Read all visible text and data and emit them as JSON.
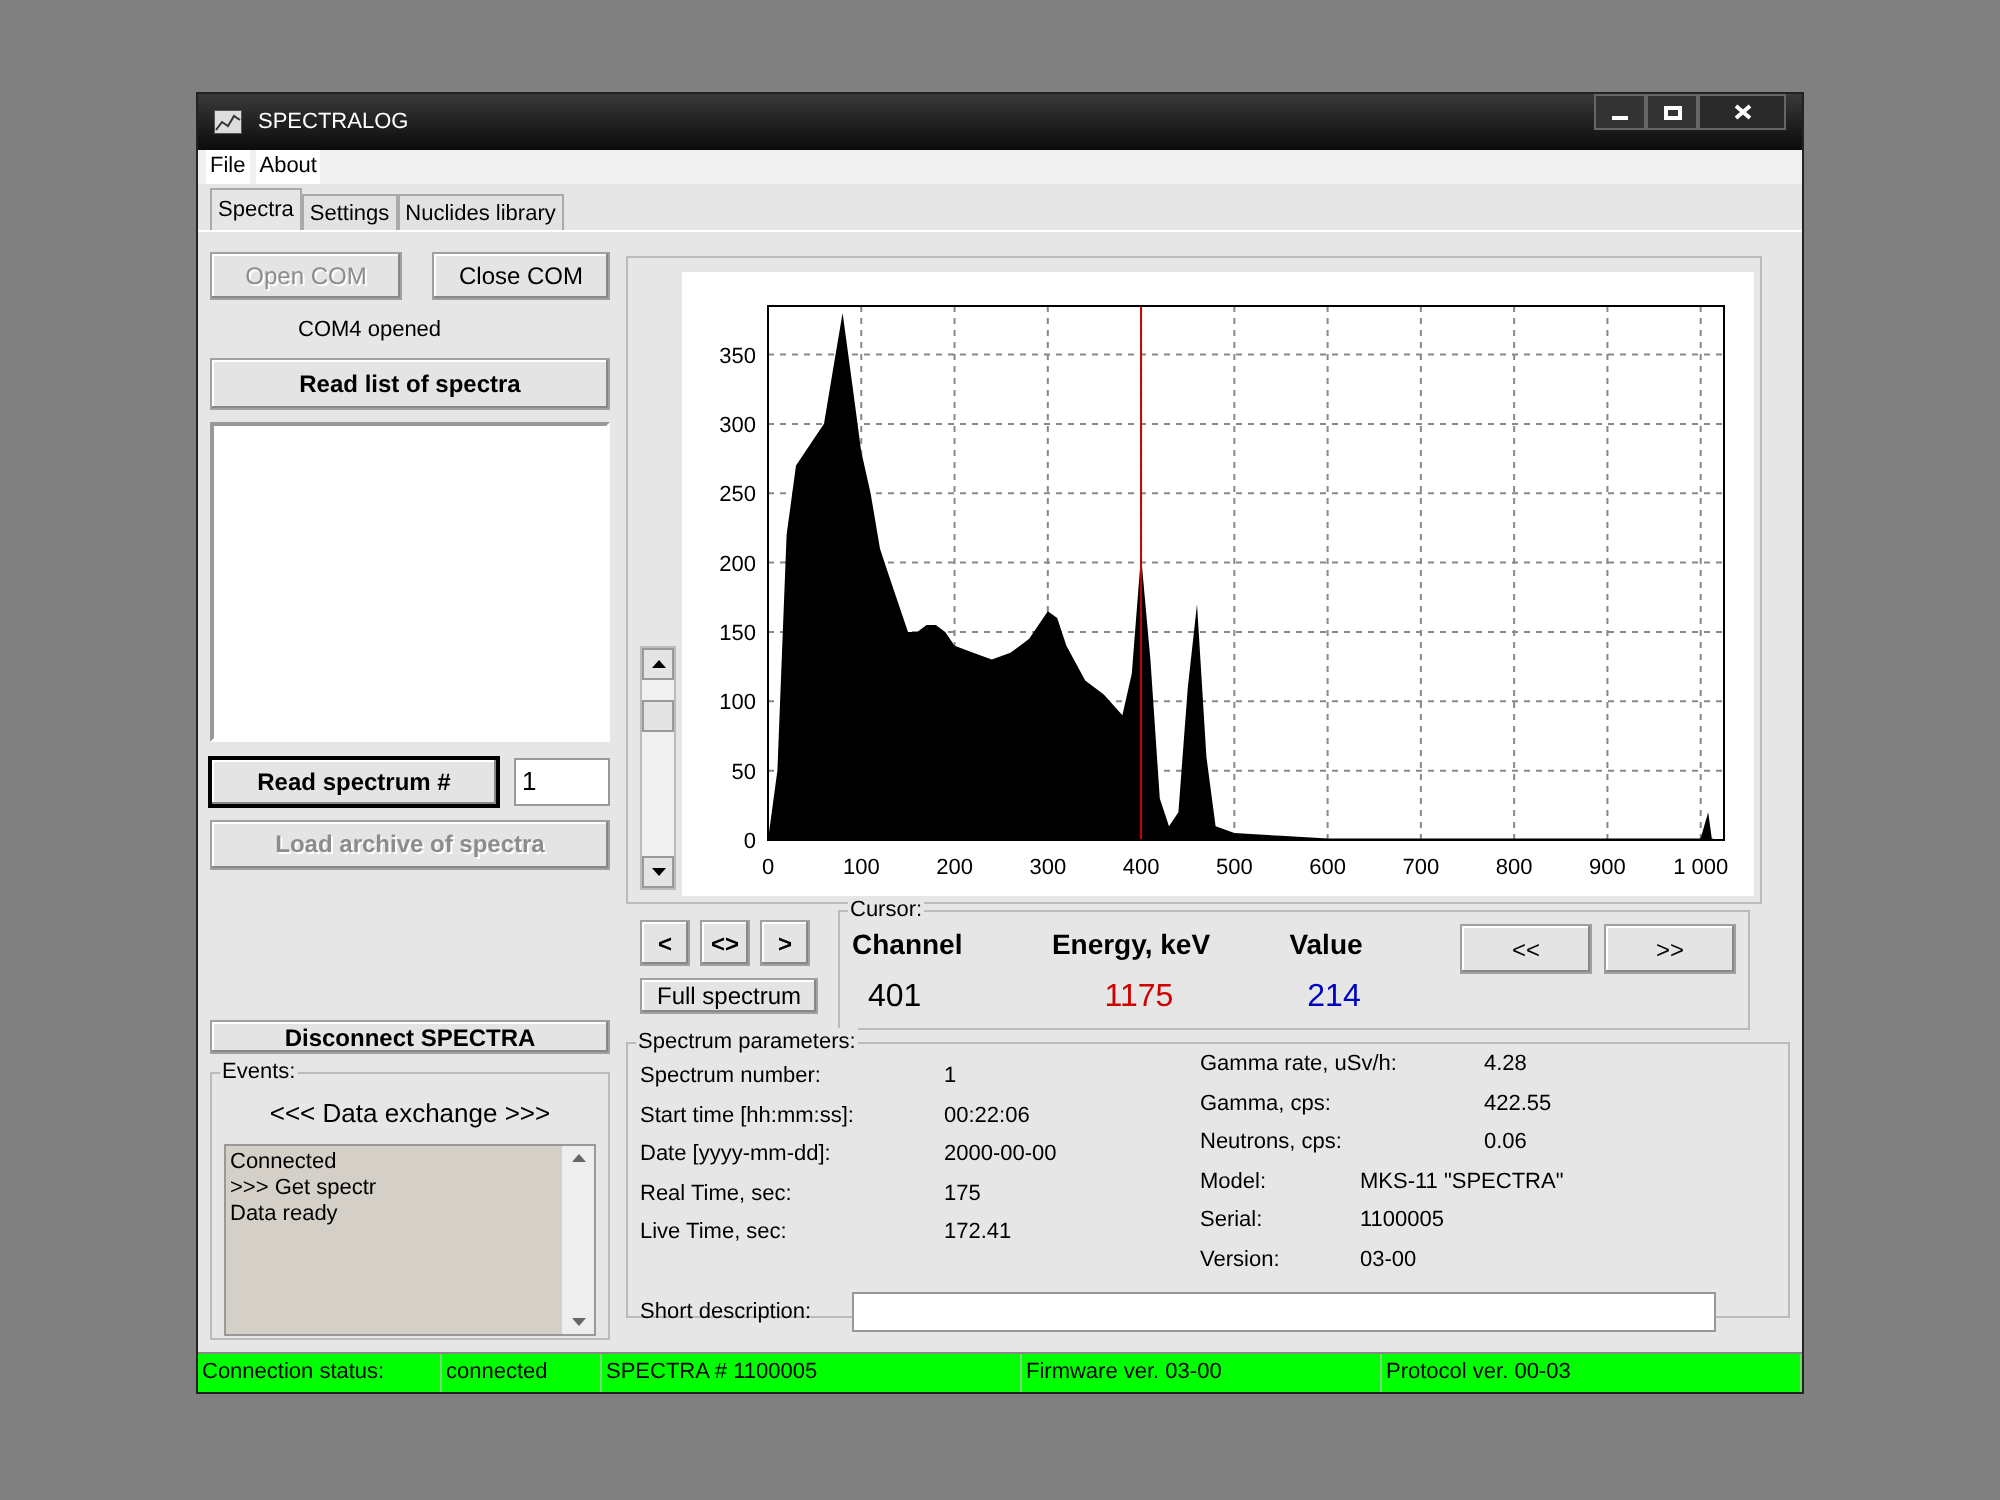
{
  "window": {
    "title": "SPECTRALOG"
  },
  "menu": [
    {
      "label": "File"
    },
    {
      "label": "About"
    }
  ],
  "tabs": [
    {
      "label": "Spectra",
      "selected": true
    },
    {
      "label": "Settings",
      "selected": false
    },
    {
      "label": "Nuclides library",
      "selected": false
    }
  ],
  "com": {
    "open_button": {
      "label": "Open COM",
      "disabled": true
    },
    "close_button": {
      "label": "Close COM",
      "disabled": false
    },
    "status": "COM4 opened"
  },
  "read_list_button": {
    "label": "Read list of spectra",
    "disabled": false
  },
  "read_spectrum": {
    "button": {
      "label": "Read spectrum #",
      "disabled": false
    },
    "value": "1"
  },
  "load_archive_button": {
    "label": "Load archive of spectra",
    "disabled": true
  },
  "disconnect_button": {
    "label": "Disconnect SPECTRA",
    "disabled": false
  },
  "events": {
    "title": "Events:",
    "heading": "<<< Data exchange >>>",
    "lines": [
      "Connected",
      ">>> Get spectr",
      "Data ready"
    ]
  },
  "chart": {
    "chart_data": {
      "type": "area",
      "x": [
        0,
        10,
        20,
        30,
        40,
        50,
        60,
        70,
        80,
        90,
        100,
        110,
        120,
        130,
        140,
        150,
        160,
        170,
        180,
        190,
        200,
        220,
        240,
        260,
        280,
        300,
        310,
        320,
        340,
        360,
        380,
        390,
        400,
        410,
        420,
        430,
        440,
        450,
        460,
        470,
        480,
        500,
        550,
        600,
        700,
        800,
        900,
        1000,
        1008,
        1012,
        1020
      ],
      "series": [
        {
          "color": "#000000",
          "values": [
            0,
            50,
            220,
            270,
            280,
            290,
            300,
            340,
            380,
            330,
            280,
            250,
            210,
            190,
            170,
            150,
            150,
            155,
            155,
            150,
            140,
            135,
            130,
            135,
            145,
            165,
            160,
            140,
            115,
            105,
            90,
            120,
            205,
            130,
            30,
            10,
            20,
            110,
            170,
            60,
            10,
            5,
            3,
            1,
            1,
            1,
            1,
            1,
            20,
            1,
            0
          ]
        }
      ],
      "xlim": [
        0,
        1025
      ],
      "ylim": [
        0,
        385
      ],
      "xticks": [
        0,
        100,
        200,
        300,
        400,
        500,
        600,
        700,
        800,
        900,
        {
          "value": 1000,
          "label": "1 000"
        }
      ],
      "yticks": [
        0,
        50,
        100,
        150,
        200,
        250,
        300,
        350
      ],
      "grid": true,
      "ref_lines": [
        {
          "axis": "x",
          "value": 400,
          "color": "#cc0000"
        }
      ]
    }
  },
  "nav_buttons": [
    {
      "label": "<"
    },
    {
      "label": "<>"
    },
    {
      "label": ">"
    }
  ],
  "full_spectrum_button": {
    "label": "Full spectrum"
  },
  "cursor": {
    "title": "Cursor:",
    "fields": [
      {
        "label": "Channel",
        "value": "401",
        "color": "#000000"
      },
      {
        "label": "Energy, keV",
        "value": "1175",
        "color": "#d00000"
      },
      {
        "label": "Value",
        "value": "214",
        "color": "#0000c0"
      }
    ],
    "buttons": [
      {
        "label": "<<"
      },
      {
        "label": ">>"
      }
    ]
  },
  "parameters": {
    "title": "Spectrum parameters:",
    "left": [
      {
        "label": "Spectrum number:",
        "value": "1"
      },
      {
        "label": "Start time [hh:mm:ss]:",
        "value": "00:22:06"
      },
      {
        "label": "Date [yyyy-mm-dd]:",
        "value": "2000-00-00"
      },
      {
        "label": "Real Time, sec:",
        "value": "175"
      },
      {
        "label": "Live Time, sec:",
        "value": "172.41"
      }
    ],
    "right": [
      {
        "label": "Gamma rate, uSv/h:",
        "value": "4.28"
      },
      {
        "label": "Gamma, cps:",
        "value": "422.55"
      },
      {
        "label": "Neutrons, cps:",
        "value": "0.06"
      },
      {
        "label": "Model:",
        "value": "MKS-11 \"SPECTRA\""
      },
      {
        "label": "Serial:",
        "value": "1100005"
      },
      {
        "label": "Version:",
        "value": "03-00"
      }
    ],
    "description_label": "Short description:"
  },
  "status_bar": [
    "Connection status:",
    "connected",
    "SPECTRA # 1100005",
    "Firmware ver. 03-00",
    "Protocol ver. 00-03"
  ]
}
